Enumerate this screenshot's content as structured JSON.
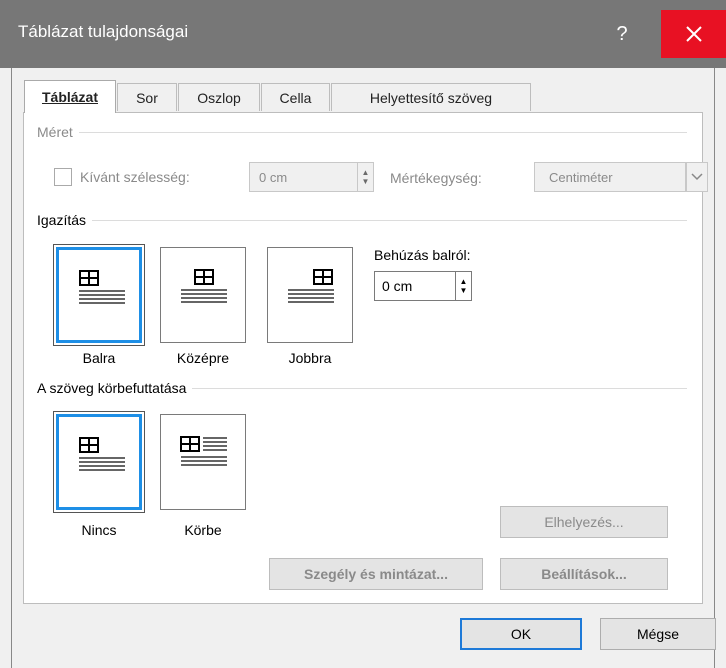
{
  "window": {
    "title": "Táblázat tulajdonságai",
    "help_glyph": "?",
    "close_glyph": "✕"
  },
  "tabs": [
    {
      "label": "Táblázat",
      "active": true
    },
    {
      "label": "Sor",
      "active": false
    },
    {
      "label": "Oszlop",
      "active": false
    },
    {
      "label": "Cella",
      "active": false
    },
    {
      "label": "Helyettesítő szöveg",
      "active": false
    }
  ],
  "size": {
    "heading": "Méret",
    "checkbox_label": "Kívánt szélesség:",
    "width_value": "0 cm",
    "unit_label": "Mértékegység:",
    "unit_value": "Centiméter"
  },
  "alignment": {
    "heading": "Igazítás",
    "options": [
      "Balra",
      "Középre",
      "Jobbra"
    ],
    "selected": "Balra",
    "indent_label": "Behúzás balról:",
    "indent_value": "0 cm"
  },
  "wrapping": {
    "heading": "A szöveg körbefuttatása",
    "options": [
      "Nincs",
      "Körbe"
    ],
    "selected": "Nincs"
  },
  "buttons": {
    "positioning": "Elhelyezés...",
    "borders": "Szegély és mintázat...",
    "options": "Beállítások...",
    "ok": "OK",
    "cancel": "Mégse"
  },
  "colors": {
    "accent": "#1e8fe6",
    "close_bg": "#e81123",
    "titlebar": "#777777"
  }
}
